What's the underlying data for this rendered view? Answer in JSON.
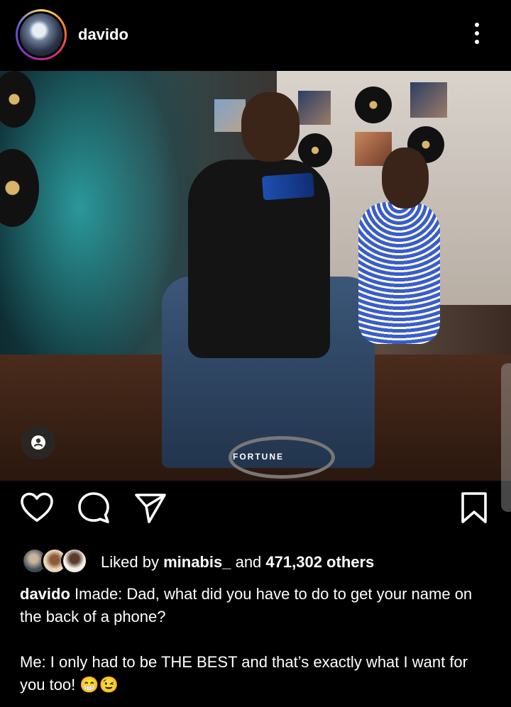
{
  "post": {
    "username": "davido",
    "photo_watermark": "FORTUNE",
    "likes": {
      "prefix": "Liked by",
      "first_liker": "minabis_",
      "joiner": "and",
      "others_count": "471,302 others"
    },
    "caption": {
      "author": "davido",
      "line1": "Imade: Dad, what did you have to do to get your name on the back of a phone?",
      "line2": "Me: I only had to be THE BEST and that’s exactly what I want for you too! 😁😉"
    }
  },
  "icons": {
    "more": "more-vertical-icon",
    "like": "heart-icon",
    "comment": "comment-icon",
    "share": "send-icon",
    "save": "bookmark-icon",
    "tags": "person-tag-icon"
  },
  "colors": {
    "background": "#000000",
    "text": "#ffffff",
    "story_ring": [
      "#feda75",
      "#fa7e1e",
      "#d62976",
      "#962fbf",
      "#4f5bd5"
    ]
  }
}
